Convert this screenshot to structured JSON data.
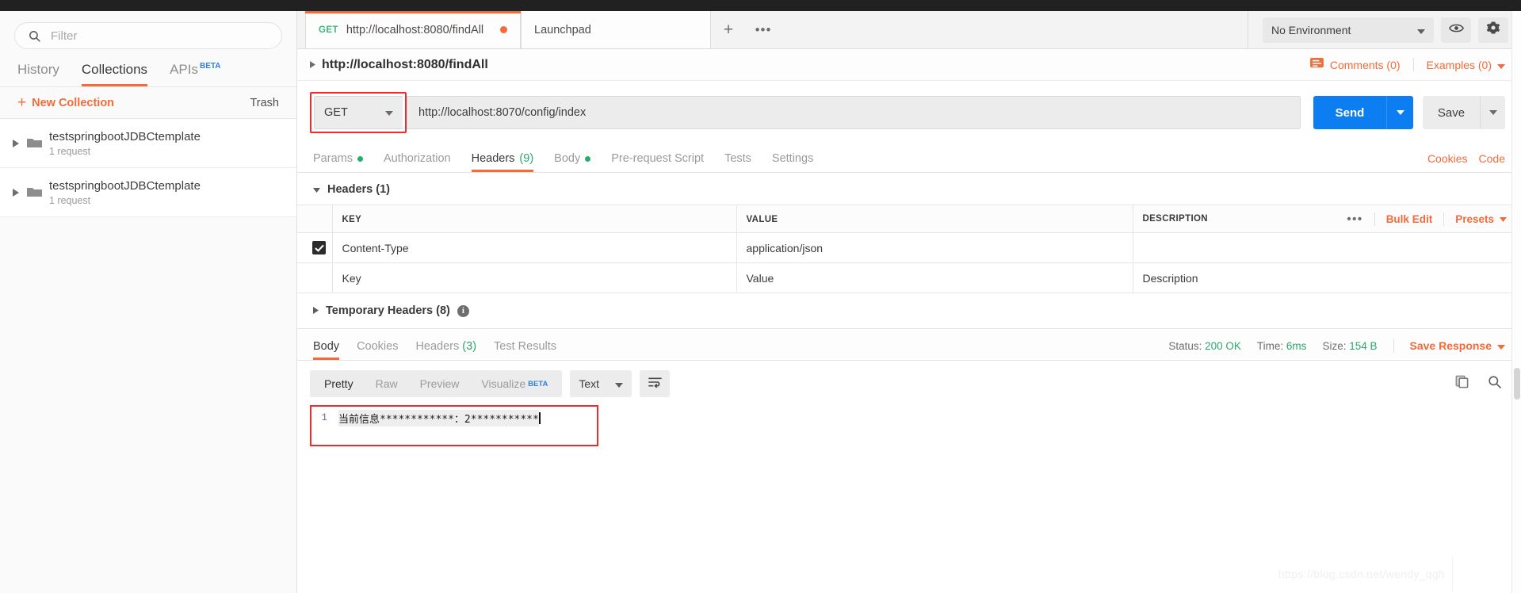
{
  "sidebar": {
    "search": {
      "placeholder": "Filter",
      "icon": "search-icon"
    },
    "tabs": [
      {
        "label": "History",
        "active": false
      },
      {
        "label": "Collections",
        "active": true
      },
      {
        "label": "APIs",
        "badge": "BETA",
        "active": false
      }
    ],
    "new_collection_label": "New Collection",
    "trash_label": "Trash",
    "collections": [
      {
        "name": "testspringbootJDBCtemplate",
        "sub": "1 request"
      },
      {
        "name": "testspringbootJDBCtemplate",
        "sub": "1 request"
      }
    ]
  },
  "tabbar": {
    "request_tab": {
      "method": "GET",
      "title": "http://localhost:8080/findAll",
      "unsaved": true
    },
    "launchpad_label": "Launchpad",
    "new_tab_label": "+",
    "more_label": "•••",
    "environment": {
      "selected": "No Environment"
    }
  },
  "breadcrumb": {
    "title": "http://localhost:8080/findAll",
    "comments_label": "Comments (0)",
    "examples_label": "Examples (0)"
  },
  "request": {
    "method": "GET",
    "url": "http://localhost:8070/config/index",
    "send_label": "Send",
    "save_label": "Save",
    "tabs": [
      {
        "label": "Params",
        "dot": true,
        "count": "",
        "active": false
      },
      {
        "label": "Authorization",
        "dot": false,
        "count": "",
        "active": false
      },
      {
        "label": "Headers",
        "dot": false,
        "count": "(9)",
        "active": true
      },
      {
        "label": "Body",
        "dot": true,
        "count": "",
        "active": false
      },
      {
        "label": "Pre-request Script",
        "dot": false,
        "count": "",
        "active": false
      },
      {
        "label": "Tests",
        "dot": false,
        "count": "",
        "active": false
      },
      {
        "label": "Settings",
        "dot": false,
        "count": "",
        "active": false
      }
    ],
    "cookies_label": "Cookies",
    "code_label": "Code"
  },
  "headers_section": {
    "title": "Headers (1)",
    "columns": {
      "key": "KEY",
      "value": "VALUE",
      "description": "DESCRIPTION"
    },
    "bulk_edit_label": "Bulk Edit",
    "presets_label": "Presets",
    "rows": [
      {
        "checked": true,
        "key": "Content-Type",
        "value": "application/json",
        "description": ""
      }
    ],
    "placeholder_row": {
      "key": "Key",
      "value": "Value",
      "description": "Description"
    },
    "temporary_headers_label": "Temporary Headers (8)"
  },
  "response": {
    "tabs": [
      {
        "label": "Body",
        "count": "",
        "active": true
      },
      {
        "label": "Cookies",
        "count": "",
        "active": false
      },
      {
        "label": "Headers",
        "count": "(3)",
        "active": false
      },
      {
        "label": "Test Results",
        "count": "",
        "active": false
      }
    ],
    "status_label": "Status:",
    "status_value": "200 OK",
    "time_label": "Time:",
    "time_value": "6ms",
    "size_label": "Size:",
    "size_value": "154 B",
    "save_response_label": "Save Response",
    "view_modes": [
      {
        "label": "Pretty",
        "active": true
      },
      {
        "label": "Raw",
        "active": false
      },
      {
        "label": "Preview",
        "active": false
      },
      {
        "label": "Visualize",
        "badge": "BETA",
        "active": false
      }
    ],
    "format_selected": "Text",
    "body_line_number": "1",
    "body_text": "当前信息************：2***********"
  },
  "watermark": "https://blog.csdn.net/wendy_qgh",
  "colors": {
    "accent": "#f26b3a",
    "send_blue": "#0c7ef2",
    "green": "#2aa96b",
    "highlight_red": "#ef2b2b",
    "beta_blue": "#2f7fe0"
  }
}
